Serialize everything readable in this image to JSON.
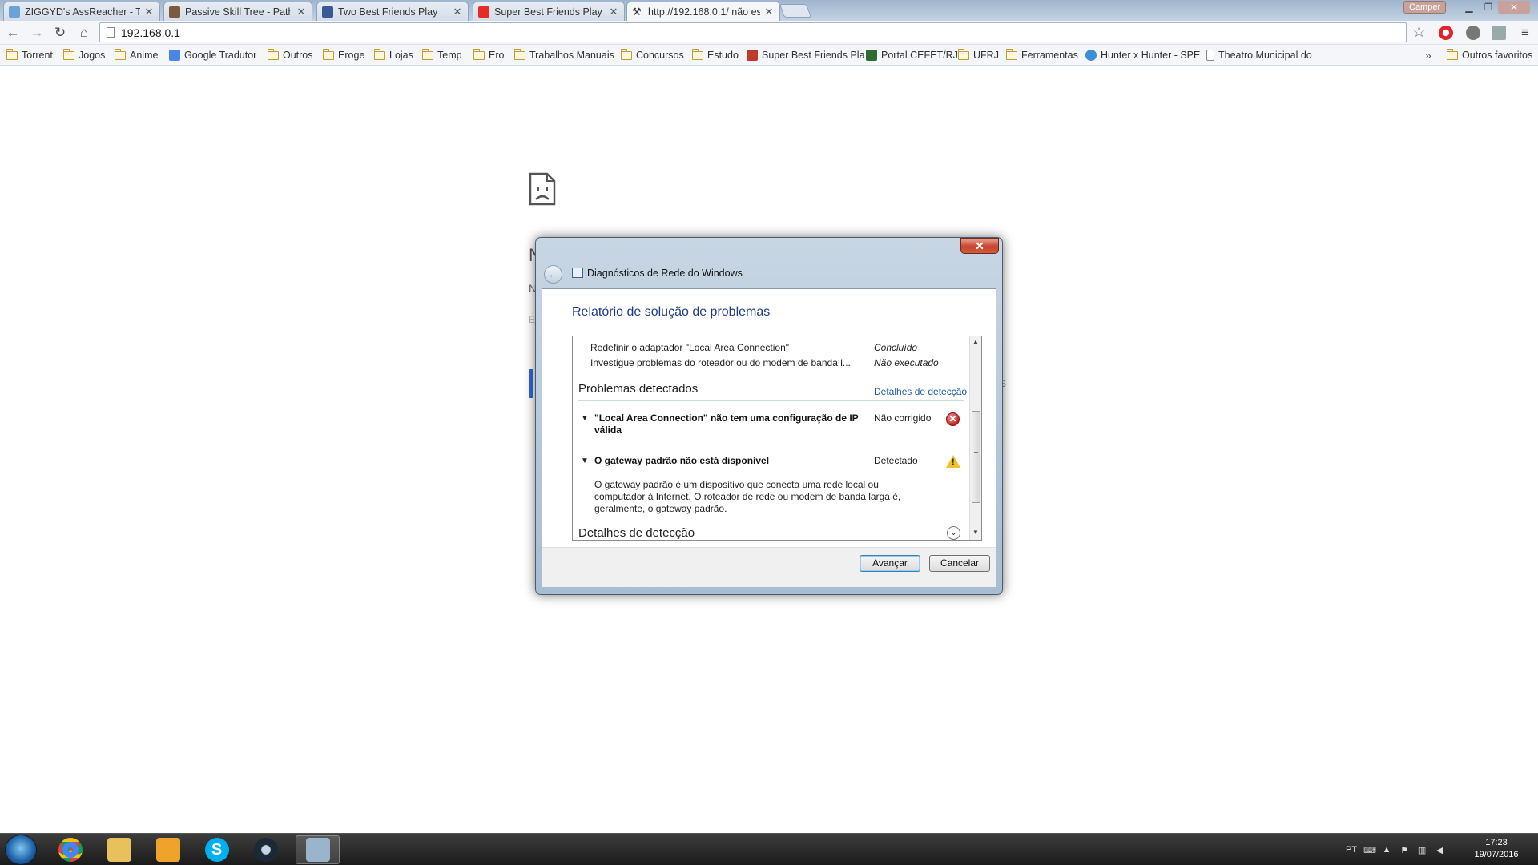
{
  "browser": {
    "tabs": [
      {
        "title": "ZIGGYD's AssReacher - To",
        "favicon_color": "#6aa3d8",
        "active": false
      },
      {
        "title": "Passive Skill Tree - Path of",
        "favicon_color": "#7d5a3c",
        "active": false
      },
      {
        "title": "Two Best Friends Play",
        "favicon_color": "#3b5998",
        "active": false
      },
      {
        "title": "Super Best Friends Play Lo",
        "favicon_color": "#e52d27",
        "active": false
      },
      {
        "title": "http://192.168.0.1/ não es",
        "favicon_color": "#333333",
        "active": true
      }
    ],
    "window_user": "Camper",
    "url": "192.168.0.1",
    "bookmarks": [
      {
        "label": "Torrent",
        "icon": "folder-icon"
      },
      {
        "label": "Jogos",
        "icon": "folder-icon"
      },
      {
        "label": "Anime",
        "icon": "folder-icon"
      },
      {
        "label": "Google Tradutor",
        "icon": "google-translate-icon"
      },
      {
        "label": "Outros",
        "icon": "folder-icon"
      },
      {
        "label": "Eroge",
        "icon": "folder-icon"
      },
      {
        "label": "Lojas",
        "icon": "folder-icon"
      },
      {
        "label": "Temp",
        "icon": "folder-icon"
      },
      {
        "label": "Ero",
        "icon": "folder-icon"
      },
      {
        "label": "Trabalhos Manuais",
        "icon": "folder-icon"
      },
      {
        "label": "Concursos",
        "icon": "folder-icon"
      },
      {
        "label": "Estudo",
        "icon": "folder-icon"
      },
      {
        "label": "Super Best Friends Pla",
        "icon": "site-icon"
      },
      {
        "label": "Portal CEFET/RJ",
        "icon": "site-icon"
      },
      {
        "label": "UFRJ",
        "icon": "folder-icon"
      },
      {
        "label": "Ferramentas",
        "icon": "folder-icon"
      },
      {
        "label": "Hunter x Hunter - SPE",
        "icon": "site-icon"
      },
      {
        "label": "Theatro Municipal do",
        "icon": "page-icon"
      }
    ],
    "other_bookmarks": "Outros favoritos",
    "overflow": "»"
  },
  "error_page": {
    "title_fragment": "N",
    "second_fragment": "N",
    "third_fragment": "E",
    "right_fragment": "s"
  },
  "dialog": {
    "app_title": "Diagnósticos de Rede do Windows",
    "heading": "Relatório de solução de problemas",
    "close_symbol": "✕",
    "steps": [
      {
        "text": "Redefinir o adaptador \"Local Area Connection\"",
        "status": "Concluído"
      },
      {
        "text": "Investigue problemas do roteador ou do modem de banda l...",
        "status": "Não executado"
      }
    ],
    "problems_title": "Problemas detectados",
    "problems_link": "Detalhes de detecção",
    "problems": [
      {
        "title": "\"Local Area Connection\" não tem uma configuração de IP válida",
        "status": "Não corrigido",
        "icon": "error-icon"
      },
      {
        "title": "O gateway padrão não está disponível",
        "status": "Detectado",
        "icon": "warning-icon",
        "description": "O gateway padrão é um dispositivo que conecta uma rede local ou computador à Internet. O roteador de rede ou modem de banda larga é, geralmente, o gateway padrão."
      }
    ],
    "details_title": "Detalhes de detecção",
    "buttons": {
      "next": "Avançar",
      "cancel": "Cancelar"
    }
  },
  "taskbar": {
    "apps": [
      {
        "name": "chrome",
        "color": "#d9a62e"
      },
      {
        "name": "explorer",
        "color": "#e9c15c"
      },
      {
        "name": "media-player",
        "color": "#f0a32a"
      },
      {
        "name": "skype",
        "color": "#00aff0"
      },
      {
        "name": "steam",
        "color": "#1b2838"
      },
      {
        "name": "network-diagnostics",
        "color": "#9ab4cc"
      }
    ],
    "language": "PT",
    "time": "17:23",
    "date": "19/07/2016"
  }
}
